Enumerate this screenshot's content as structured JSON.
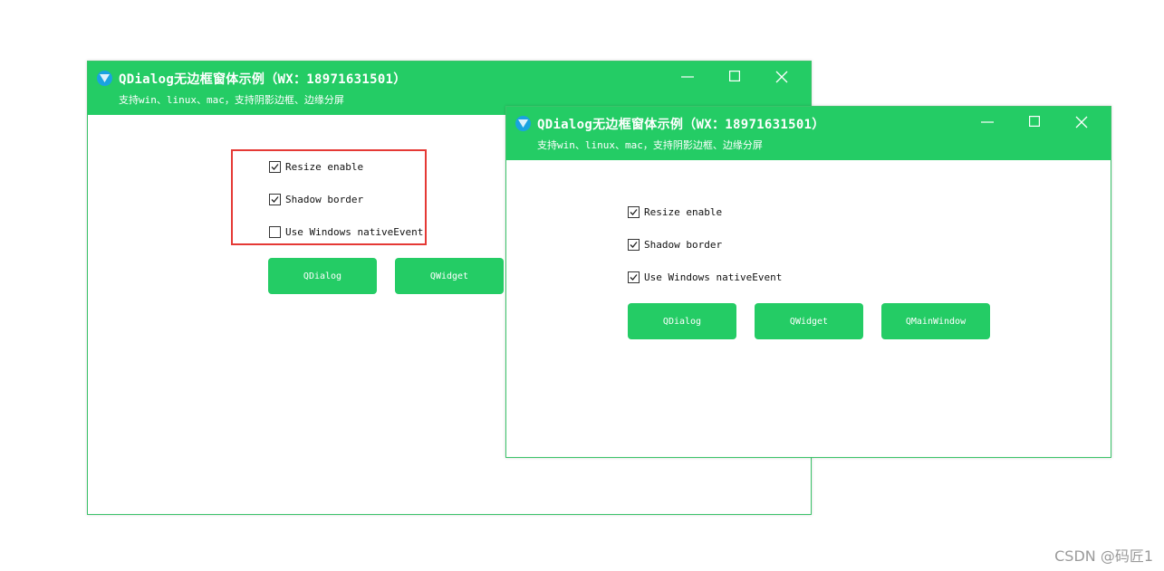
{
  "back_window": {
    "title": "QDialog无边框窗体示例（WX：18971631501）",
    "subtitle": "支持win、linux、mac，支持阴影边框、边缘分屏",
    "checkboxes": [
      {
        "label": "Resize enable",
        "checked": true
      },
      {
        "label": "Shadow border",
        "checked": true
      },
      {
        "label": "Use Windows nativeEvent",
        "checked": false
      }
    ],
    "buttons": [
      "QDialog",
      "QWidget"
    ]
  },
  "front_window": {
    "title": "QDialog无边框窗体示例（WX：18971631501）",
    "subtitle": "支持win、linux、mac，支持阴影边框、边缘分屏",
    "checkboxes": [
      {
        "label": "Resize enable",
        "checked": true
      },
      {
        "label": "Shadow border",
        "checked": true
      },
      {
        "label": "Use Windows nativeEvent",
        "checked": true
      }
    ],
    "buttons": [
      "QDialog",
      "QWidget",
      "QMainWindow"
    ]
  },
  "watermark": "CSDN @码匠1",
  "colors": {
    "titlebar": "#24cc65",
    "button": "#24cc65",
    "highlight": "#e53935",
    "app_icon": "#1aa3e0"
  },
  "icons": [
    "app-icon",
    "minimize-icon",
    "maximize-icon",
    "close-icon",
    "check-icon"
  ]
}
